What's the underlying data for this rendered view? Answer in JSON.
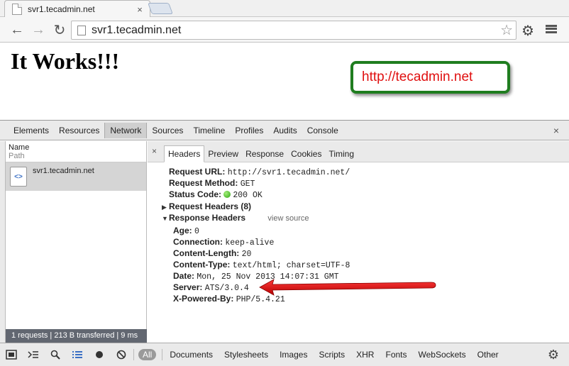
{
  "browser": {
    "tab": {
      "title": "svr1.tecadmin.net",
      "close": "×"
    },
    "toolbar": {
      "back": "←",
      "forward": "→",
      "reload": "↻",
      "url": "svr1.tecadmin.net",
      "star": "☆",
      "gear": "⚙"
    }
  },
  "page": {
    "heading": "It Works!!!",
    "banner": "http://tecadmin.net",
    "banner_colors": {
      "border": "#1f7d1f",
      "text": "#e01010"
    }
  },
  "devtools": {
    "tabs": [
      "Elements",
      "Resources",
      "Network",
      "Sources",
      "Timeline",
      "Profiles",
      "Audits",
      "Console"
    ],
    "active_tab": "Network",
    "close": "×",
    "left_pane": {
      "header_name": "Name",
      "header_path": "Path",
      "row_name": "svr1.tecadmin.net",
      "row_icon": "<>",
      "status": "1 requests  |  213 B transferred  |  9 ms"
    },
    "right_pane": {
      "close": "×",
      "tabs": [
        "Headers",
        "Preview",
        "Response",
        "Cookies",
        "Timing"
      ],
      "active_tab": "Headers",
      "general": [
        {
          "key": "Request URL:",
          "value": "http://svr1.tecadmin.net/"
        },
        {
          "key": "Request Method:",
          "value": "GET"
        },
        {
          "key": "Status Code:",
          "value": "200 OK"
        }
      ],
      "request_headers": {
        "label": "Request Headers (8)",
        "collapsed": true
      },
      "response_headers": {
        "label": "Response Headers",
        "view_source": "view source",
        "items": [
          {
            "key": "Age:",
            "value": "0"
          },
          {
            "key": "Connection:",
            "value": "keep-alive"
          },
          {
            "key": "Content-Length:",
            "value": "20"
          },
          {
            "key": "Content-Type:",
            "value": "text/html; charset=UTF-8"
          },
          {
            "key": "Date:",
            "value": "Mon, 25 Nov 2013 14:07:31 GMT"
          },
          {
            "key": "Server:",
            "value": "ATS/3.0.4"
          },
          {
            "key": "X-Powered-By:",
            "value": "PHP/5.4.21"
          }
        ]
      }
    },
    "bottom_bar": {
      "filters": [
        "All",
        "Documents",
        "Stylesheets",
        "Images",
        "Scripts",
        "XHR",
        "Fonts",
        "WebSockets",
        "Other"
      ],
      "active_filter": "All"
    },
    "annotation_arrow_color": "#e01010"
  }
}
